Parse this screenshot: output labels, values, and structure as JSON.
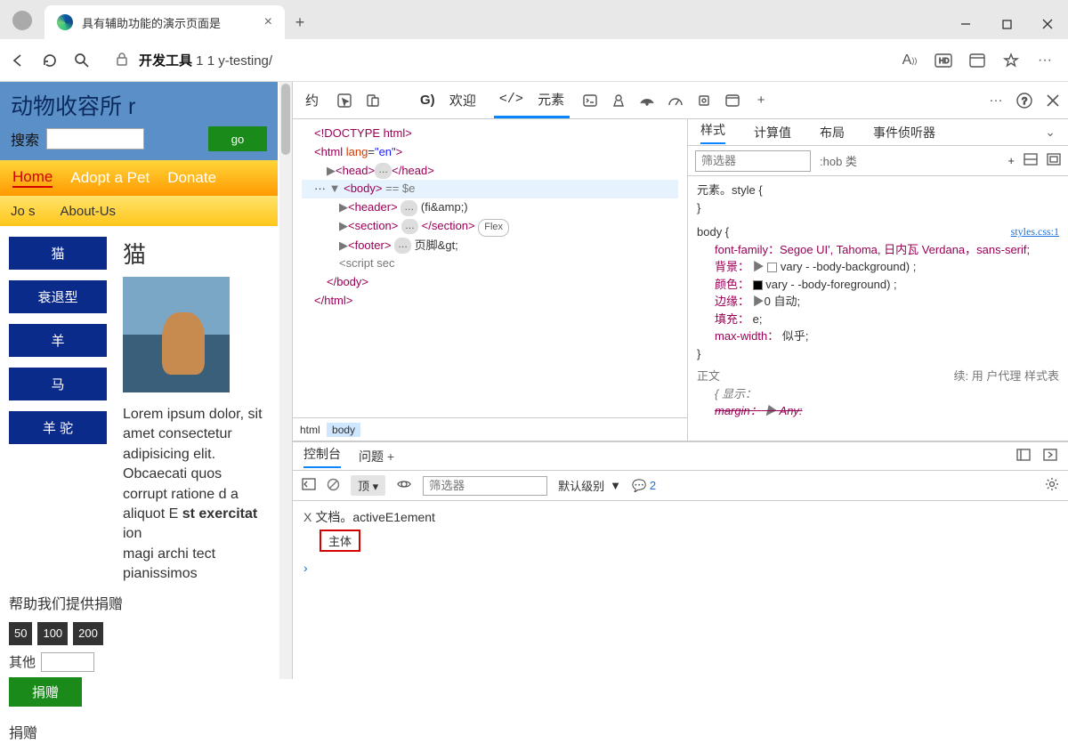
{
  "browser": {
    "tab_title": "具有辅助功能的演示页面是",
    "url_bold": "开发工具",
    "url_rest": " 1 1 y-testing/"
  },
  "page": {
    "title": "动物收容所    r",
    "search_label": "搜索",
    "go": "go",
    "nav": [
      "Home",
      "Adopt a Pet",
      "Donate"
    ],
    "nav2": [
      "Jo s",
      "About-Us"
    ],
    "side": [
      "猫",
      "衰退型",
      "羊",
      "马",
      "羊 驼"
    ],
    "heading": "猫",
    "lorem": {
      "p1": "Lorem ipsum dolor, sit amet consectetur adipisicing elit. Obcaecati quos corrupt ratione d a aliquot E",
      "p2": "st exercitat",
      "p3": "ion",
      "p4": "magi archi tect pianissimos"
    },
    "help": "帮助我们提供捐赠",
    "chips": [
      "50",
      "100",
      "200"
    ],
    "other": "其他",
    "donate": "捐赠",
    "footer": "捐赠"
  },
  "devtools": {
    "tabs": {
      "yue": "约",
      "welcome_prefix": "G)",
      "welcome": "欢迎",
      "elements": "元素"
    },
    "dom": {
      "l1": "<!DOCTYPE html>",
      "l2a": "<",
      "l2b": "html",
      "l2c": " lang",
      "l2d": "=",
      "l2e": "\"en\"",
      "l2f": ">",
      "l3a": "<",
      "l3b": "head",
      "l3c": ">",
      "l3d": "</",
      "l3e": "head",
      "l3f": ">",
      "sel_a": "<",
      "sel_b": "body",
      "sel_c": ">",
      "sel_eq": " == ",
      "sel_d": "$e",
      "hdr_a": "<",
      "hdr_b": "header",
      "hdr_c": ">",
      "hdr_txt": " (fi&amp;)",
      "sec_a": "<",
      "sec_b": "section",
      "sec_c": ">",
      "sec_d": " </",
      "sec_e": "section",
      "sec_f": "> ",
      "flex": "Flex",
      "ftr_a": "<",
      "ftr_b": "footer",
      "ftr_c": ">",
      "ftr_txt": " 页脚&gt;",
      "scr": "<script sec",
      "bcl_a": "</",
      "bcl_b": "body",
      "bcl_c": ">",
      "hcl_a": "</",
      "hcl_b": "html",
      "hcl_c": ">"
    },
    "crumb": {
      "a": "html",
      "b": "body"
    },
    "styles": {
      "tabs": [
        "样式",
        "计算值",
        "布局",
        "事件侦听器"
      ],
      "filter": "筛选器",
      "hob": ":hob 类",
      "r1": "元素。style {",
      "link": "styles.css:1",
      "body_sel": "body {",
      "ff": "font-family：Segoe          UI',    Tahoma,    日内瓦 Verdana，sans-serif;",
      "bg": "背景：",
      "bg_v": "vary - -body-background) ;",
      "col": "颜色：",
      "col_v": "vary - -body-foreground) ;",
      "mg": "边缘：",
      "mg_v": "0 自动;",
      "pd": "填充：",
      "pd_v": "e;",
      "mw": "max-width：",
      "mw_v": "似乎;",
      "ua": "正文",
      "ua_r": "续: 用 户代理 样式表",
      "disp": "{ 显示：",
      "margin": "margin：",
      "any": "Any:"
    },
    "console": {
      "tabs": [
        "控制台",
        "问题"
      ],
      "top": "顶",
      "filter": "筛选器",
      "level": "默认级别",
      "count": "2",
      "line": "文档。activeE1ement",
      "result": "主体"
    }
  }
}
